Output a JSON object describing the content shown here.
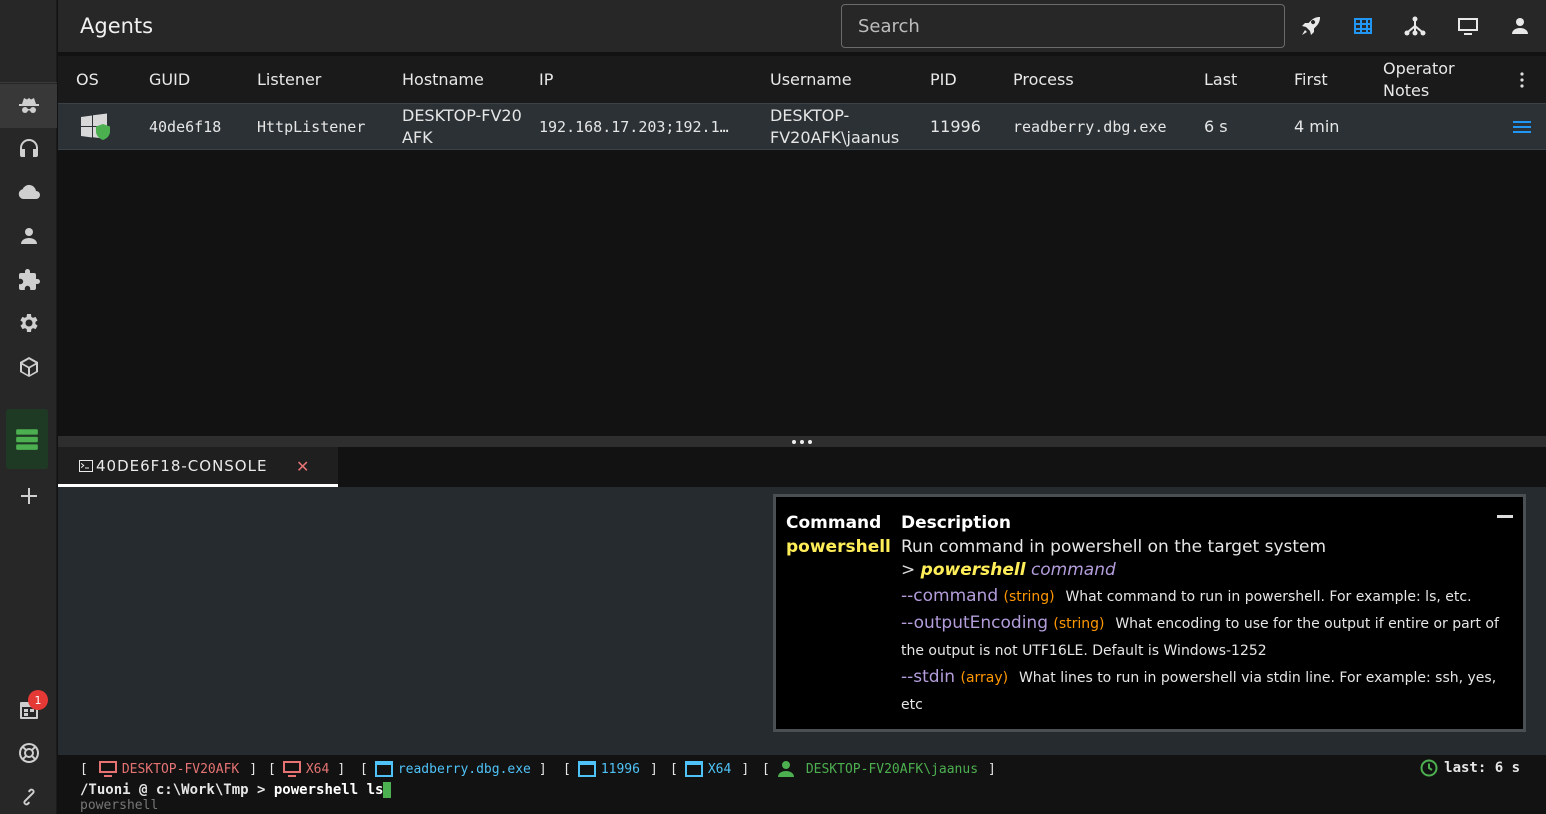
{
  "app": {
    "title": "Agents"
  },
  "search": {
    "placeholder": "Search"
  },
  "topbar_icons": [
    "rocket-icon",
    "table-icon",
    "network-icon",
    "monitor-icon",
    "user-icon"
  ],
  "sidebar_icons": [
    "agents-spy-icon",
    "headset-icon",
    "cloud-icon",
    "user-icon",
    "puzzle-icon",
    "gear-icon",
    "package-icon",
    "server-list-icon",
    "plus-icon",
    "calendar-icon",
    "lifebuoy-icon",
    "link-icon"
  ],
  "sidebar": {
    "badge_count": "1"
  },
  "table": {
    "columns": [
      "OS",
      "GUID",
      "Listener",
      "Hostname",
      "IP",
      "Username",
      "PID",
      "Process",
      "Last",
      "First",
      "Operator Notes"
    ],
    "rows": [
      {
        "os": "windows",
        "guid": "40de6f18",
        "listener": "HttpListener",
        "hostname": "DESKTOP-FV20AFK",
        "ip": "192.168.17.203;192.1…",
        "username": "DESKTOP-FV20AFK\\jaanus",
        "pid": "11996",
        "process": "readberry.dbg.exe",
        "last": "6 s",
        "first": "4 min",
        "notes": ""
      }
    ]
  },
  "console": {
    "tab_label": "40DE6F18-CONSOLE",
    "close_glyph": "✕"
  },
  "help": {
    "col_command": "Command",
    "col_description": "Description",
    "command": "powershell",
    "description": "Run command in powershell on the target system",
    "usage_prefix": ">",
    "usage_cmd": "powershell",
    "usage_arg": "command",
    "flags": [
      {
        "name": "--command",
        "type": "(string)",
        "desc": "What command to run in powershell. For example: ls, etc."
      },
      {
        "name": "--outputEncoding",
        "type": "(string)",
        "desc": "What encoding to use for the output if entire or part of the output is not UTF16LE. Default is Windows-1252"
      },
      {
        "name": "--stdin",
        "type": "(array)",
        "desc": "What lines to run in powershell via stdin line. For example: ssh, yes, etc"
      }
    ]
  },
  "status": {
    "host": "DESKTOP-FV20AFK",
    "os_arch": "X64",
    "process": "readberry.dbg.exe",
    "pid": "11996",
    "proc_arch": "X64",
    "user": "DESKTOP-FV20AFK\\jaanus",
    "last": "last: 6 s"
  },
  "prompt": {
    "path": "/Tuoni @ c:\\Work\\Tmp >",
    "input": "powershell ls",
    "suggestion": "powershell"
  },
  "colors": {
    "accent_blue": "#2196f3",
    "accent_green": "#4caf50",
    "host_red": "#e57373",
    "flag_purple": "#b39ddb",
    "type_orange": "#ff9800",
    "cmd_yellow": "#ffee58"
  }
}
